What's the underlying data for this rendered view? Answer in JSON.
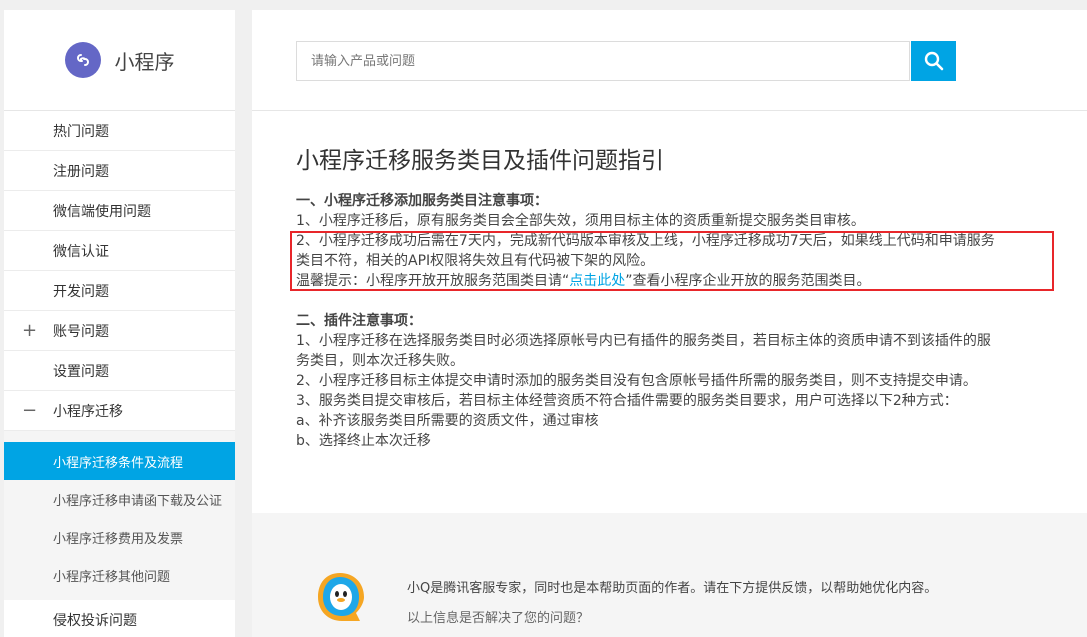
{
  "brand": {
    "title": "小程序",
    "icon": "link-icon",
    "color": "#6467c6"
  },
  "sidebar": {
    "items": [
      {
        "label": "热门问题"
      },
      {
        "label": "注册问题"
      },
      {
        "label": "微信端使用问题"
      },
      {
        "label": "微信认证"
      },
      {
        "label": "开发问题"
      },
      {
        "label": "账号问题",
        "toggle": "+"
      },
      {
        "label": "设置问题"
      },
      {
        "label": "小程序迁移",
        "toggle": "−"
      }
    ],
    "sub_items": [
      {
        "label": "小程序迁移条件及流程",
        "active": true
      },
      {
        "label": "小程序迁移申请函下载及公证"
      },
      {
        "label": "小程序迁移费用及发票"
      },
      {
        "label": "小程序迁移其他问题"
      }
    ],
    "after_items": [
      {
        "label": "侵权投诉问题"
      }
    ]
  },
  "search": {
    "placeholder": "请输入产品或问题",
    "icon": "search-icon",
    "accent": "#00a4e4"
  },
  "article": {
    "title": "小程序迁移服务类目及插件问题指引",
    "section1_heading": "一、小程序迁移添加服务类目注意事项：",
    "s1_item1": "1、小程序迁移后，原有服务类目会全部失效，须用目标主体的资质重新提交服务类目审核。",
    "s1_item2_line1": "2、小程序迁移成功后需在7天内，完成新代码版本审核及上线，小程序迁移成功7天后，如果线上代码和申请服务",
    "s1_item2_line2": "类目不符，相关的API权限将失效且有代码被下架的风险。",
    "tip_prefix": "温馨提示：小程序开放开放服务范围类目请“",
    "tip_link": "点击此处",
    "tip_suffix": "”查看小程序企业开放的服务范围类目。",
    "section2_heading": "二、插件注意事项：",
    "s2_item1_line1": "1、小程序迁移在选择服务类目时必须选择原帐号内已有插件的服务类目，若目标主体的资质申请不到该插件的服",
    "s2_item1_line2": "务类目，则本次迁移失败。",
    "s2_item2": "2、小程序迁移目标主体提交申请时添加的服务类目没有包含原帐号插件所需的服务类目，则不支持提交申请。",
    "s2_item3": "3、服务类目提交审核后，若目标主体经营资质不符合插件需要的服务类目要求，用户可选择以下2种方式：",
    "s2_item_a": "a、补齐该服务类目所需要的资质文件，通过审核",
    "s2_item_b": "b、选择终止本次迁移",
    "highlight_color": "#e8262a"
  },
  "feedback": {
    "icon": "qq-penguin-icon",
    "line1": "小Q是腾讯客服专家，同时也是本帮助页面的作者。请在下方提供反馈，以帮助她优化内容。",
    "line2": "以上信息是否解决了您的问题？"
  }
}
